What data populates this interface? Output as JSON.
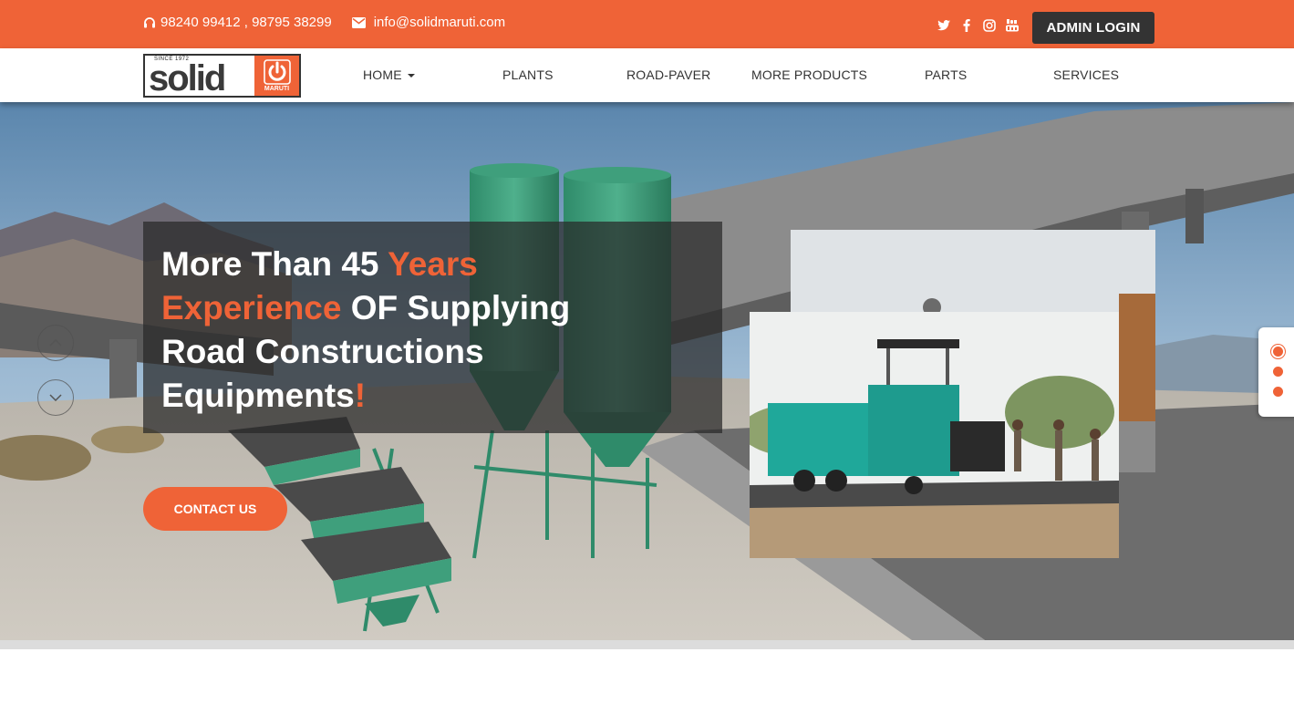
{
  "topbar": {
    "phone": "98240 99412 , 98795 38299",
    "email": "info@solidmaruti.com",
    "admin_login": "ADMIN LOGIN",
    "social_icons": [
      "twitter-icon",
      "facebook-icon",
      "instagram-icon",
      "youtube-icon"
    ]
  },
  "logo": {
    "since": "SINCE 1972",
    "word": "solid",
    "sub": "MARUTI"
  },
  "nav": {
    "items": [
      "HOME",
      "PLANTS",
      "ROAD-PAVER",
      "MORE PRODUCTS",
      "PARTS",
      "SERVICES"
    ]
  },
  "hero": {
    "headline": {
      "p1": "More Than 45 ",
      "p2": "Years",
      "p3": "Experience",
      "p4": " OF Supplying",
      "p5": "Road Constructions",
      "p6": "Equipments",
      "p7": "!"
    },
    "contact_button": "CONTACT US",
    "slide_count": 3,
    "active_slide": 1
  },
  "colors": {
    "accent": "#ef6337",
    "dark": "#333333"
  }
}
